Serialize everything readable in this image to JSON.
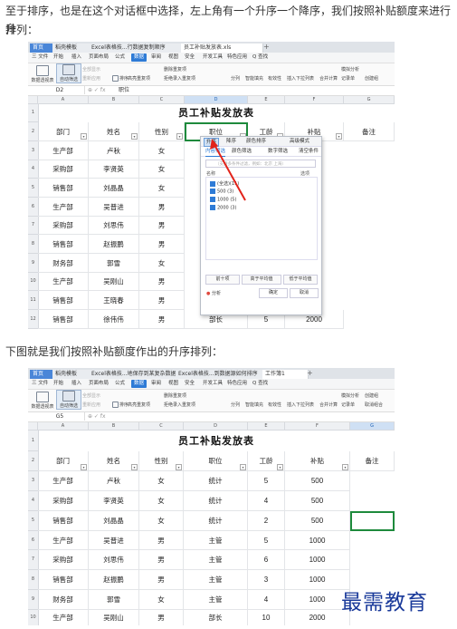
{
  "intro_text": {
    "line1": "至于排序，也是在这个对话框中选择，左上角有一个升序一个降序，我们按照补贴额度来进行升",
    "line2": "排列："
  },
  "middle_text": "下图就是我们按照补贴额度作出的升序排列：",
  "watermark": "最需教育",
  "screenshot1": {
    "tabs": [
      {
        "label": "首页",
        "type": "home"
      },
      {
        "label": "稻壳模板",
        "type": "tab"
      },
      {
        "label": "Excel表格技...行数据复制顺序",
        "type": "tab"
      },
      {
        "label": "员工补贴发放表.xls",
        "type": "active"
      }
    ],
    "menu": [
      "三 文件",
      "开始",
      "插入",
      "页面布局",
      "公式",
      "数据",
      "审阅",
      "视图",
      "安全",
      "开发工具",
      "特色应用",
      "Q 查找"
    ],
    "menu_selected": "数据",
    "ribbon": {
      "pivot": "数据透视表",
      "autofilter": "自动筛选",
      "all": "全部显示",
      "reapply": "重新应用",
      "sort": "排序",
      "highlight_dup": "高亮重复项",
      "reject_dup": "拒绝录入重复项",
      "delete_dup": "删除重复项",
      "split": "分列",
      "fill": "智能填充",
      "validity": "有效性",
      "dropdown": "插入下拉列表",
      "consolidate": "合并计算",
      "simulate": "模拟分析",
      "record": "记录单",
      "group": "创建组",
      "ungroup": "取消组合"
    },
    "cell_ref": "D2",
    "formula_value": "职位",
    "columns": [
      "A",
      "B",
      "C",
      "D",
      "E",
      "F",
      "G"
    ],
    "rows": [
      "1",
      "2",
      "3",
      "4",
      "5",
      "6",
      "7",
      "8",
      "9",
      "10",
      "11",
      "12"
    ],
    "title": "员工补贴发放表",
    "headers": [
      "部门",
      "姓名",
      "性别",
      "职位",
      "工龄",
      "补贴",
      "备注"
    ],
    "data": [
      [
        "生产部",
        "卢秋",
        "女"
      ],
      [
        "采购部",
        "李贤英",
        "女"
      ],
      [
        "销售部",
        "刘晶晶",
        "女"
      ],
      [
        "生产部",
        "吴普进",
        "男"
      ],
      [
        "采购部",
        "刘思伟",
        "男"
      ],
      [
        "销售部",
        "赵振鹏",
        "男"
      ],
      [
        "财务部",
        "郭雪",
        "女"
      ],
      [
        "生产部",
        "吴刚山",
        "男"
      ],
      [
        "销售部",
        "王晓春",
        "男"
      ]
    ],
    "last_row": [
      "销售部",
      "徐伟伟",
      "男",
      "部长",
      "5",
      "2000"
    ],
    "popup": {
      "asc": "升序",
      "desc": "降序",
      "color_sort": "颜色排序",
      "advanced": "高级模式",
      "tab_content": "内容筛选",
      "tab_color": "颜色筛选",
      "tab_number": "数字筛选",
      "clear": "清空条件",
      "search_placeholder": "（支持多条件过滤，例如：北京 上海）",
      "name_label": "名称",
      "options_label": "选项",
      "items": [
        "(全选)(11)",
        "500 (3)",
        "1000 (5)",
        "2000 (3)"
      ],
      "btn_top10": "前十项",
      "btn_above": "高于平均值",
      "btn_below": "低于平均值",
      "analyze": "分析",
      "ok": "确定",
      "cancel": "取消"
    }
  },
  "screenshot2": {
    "tabs": [
      {
        "label": "首页",
        "type": "home"
      },
      {
        "label": "稻壳模板",
        "type": "tab"
      },
      {
        "label": "Excel表格技...地保存到某复杂数据库",
        "type": "tab"
      },
      {
        "label": "Excel表格技...到数据源如何排序",
        "type": "tab"
      },
      {
        "label": "工作簿1",
        "type": "active"
      }
    ],
    "menu": [
      "三 文件",
      "开始",
      "插入",
      "页面布局",
      "公式",
      "数据",
      "审阅",
      "视图",
      "安全",
      "开发工具",
      "特色应用",
      "Q 查找"
    ],
    "menu_selected": "数据",
    "cell_ref": "G5",
    "formula_value": "",
    "columns": [
      "A",
      "B",
      "C",
      "D",
      "E",
      "F",
      "G"
    ],
    "rows": [
      "1",
      "2",
      "3",
      "4",
      "5",
      "6",
      "7",
      "8",
      "9",
      "10"
    ],
    "title": "员工补贴发放表",
    "headers": [
      "部门",
      "姓名",
      "性别",
      "职位",
      "工龄",
      "补贴",
      "备注"
    ],
    "data": [
      [
        "生产部",
        "卢秋",
        "女",
        "统计",
        "5",
        "500"
      ],
      [
        "采购部",
        "李贤英",
        "女",
        "统计",
        "4",
        "500"
      ],
      [
        "销售部",
        "刘晶晶",
        "女",
        "统计",
        "2",
        "500"
      ],
      [
        "生产部",
        "吴普进",
        "男",
        "主管",
        "5",
        "1000"
      ],
      [
        "采购部",
        "刘思伟",
        "男",
        "主管",
        "6",
        "1000"
      ],
      [
        "销售部",
        "赵振鹏",
        "男",
        "主管",
        "3",
        "1000"
      ],
      [
        "财务部",
        "郭雪",
        "女",
        "主管",
        "4",
        "1000"
      ],
      [
        "生产部",
        "吴刚山",
        "男",
        "部长",
        "10",
        "2000"
      ]
    ]
  }
}
